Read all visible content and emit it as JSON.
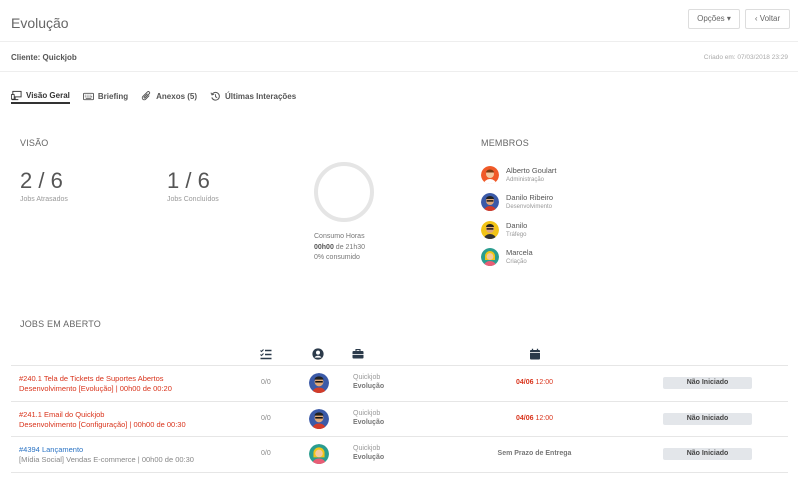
{
  "header": {
    "title": "Evolução",
    "options_label": "Opções ▾",
    "back_label": "‹ Voltar"
  },
  "client": {
    "label": "Cliente: Quickjob",
    "created": "Criado em: 07/03/2018 23:29"
  },
  "tabs": [
    {
      "label": "Visão Geral",
      "icon": "monitor-icon",
      "active": true
    },
    {
      "label": "Briefing",
      "icon": "keyboard-icon",
      "active": false
    },
    {
      "label": "Anexos (5)",
      "icon": "paperclip-icon",
      "active": false
    },
    {
      "label": "Últimas Interações",
      "icon": "history-icon",
      "active": false
    }
  ],
  "overview": {
    "title": "VISÃO",
    "late_value": "2 / 6",
    "late_label": "Jobs Atrasados",
    "done_value": "1 / 6",
    "done_label": "Jobs Concluídos",
    "hours_label": "Consumo Horas",
    "hours_used": "00h00",
    "hours_of": " de 21h30",
    "hours_percent": "0% consumido",
    "consumed_fraction": 0
  },
  "members": {
    "title": "MEMBROS",
    "list": [
      {
        "name": "Alberto Goulart",
        "role": "Administração",
        "avatar_color": "#f05a28"
      },
      {
        "name": "Danilo Ribeiro",
        "role": "Desenvolvimento",
        "avatar_color": "#3b5aa8"
      },
      {
        "name": "Danilo",
        "role": "Tráfego",
        "avatar_color": "#f2c417"
      },
      {
        "name": "Marcela",
        "role": "Criação",
        "avatar_color": "#2a9d8f"
      }
    ]
  },
  "jobs": {
    "title": "JOBS EM ABERTO",
    "column_icons": [
      "checklist-icon",
      "user-icon",
      "briefcase-icon",
      "calendar-icon"
    ],
    "rows": [
      {
        "title": "#240.1 Tela de Tickets de Suportes Abertos",
        "subtitle": "Desenvolvimento [Evolução] | 00h00 de 00:20",
        "color": "#d9331b",
        "count": "0/0",
        "client": "Quickjob",
        "project": "Evolução",
        "due_date": "04/06",
        "due_time": " 12:00",
        "no_due": "",
        "status": "Não Iniciado",
        "avatar_color": "#3b5aa8"
      },
      {
        "title": "#241.1 Email do Quickjob",
        "subtitle": "Desenvolvimento [Configuração] | 00h00 de 00:30",
        "color": "#d9331b",
        "count": "0/0",
        "client": "Quickjob",
        "project": "Evolução",
        "due_date": "04/06",
        "due_time": " 12:00",
        "no_due": "",
        "status": "Não Iniciado",
        "avatar_color": "#3b5aa8"
      },
      {
        "title": "#4394 Lançamento",
        "subtitle": "[Mídia Social] Vendas E-commerce | 00h00 de 00:30",
        "color": "#2a73c4",
        "count": "0/0",
        "client": "Quickjob",
        "project": "Evolução",
        "due_date": "",
        "due_time": "",
        "no_due": "Sem Prazo de Entrega",
        "status": "Não Iniciado",
        "avatar_color": "#2a9d8f"
      }
    ]
  }
}
